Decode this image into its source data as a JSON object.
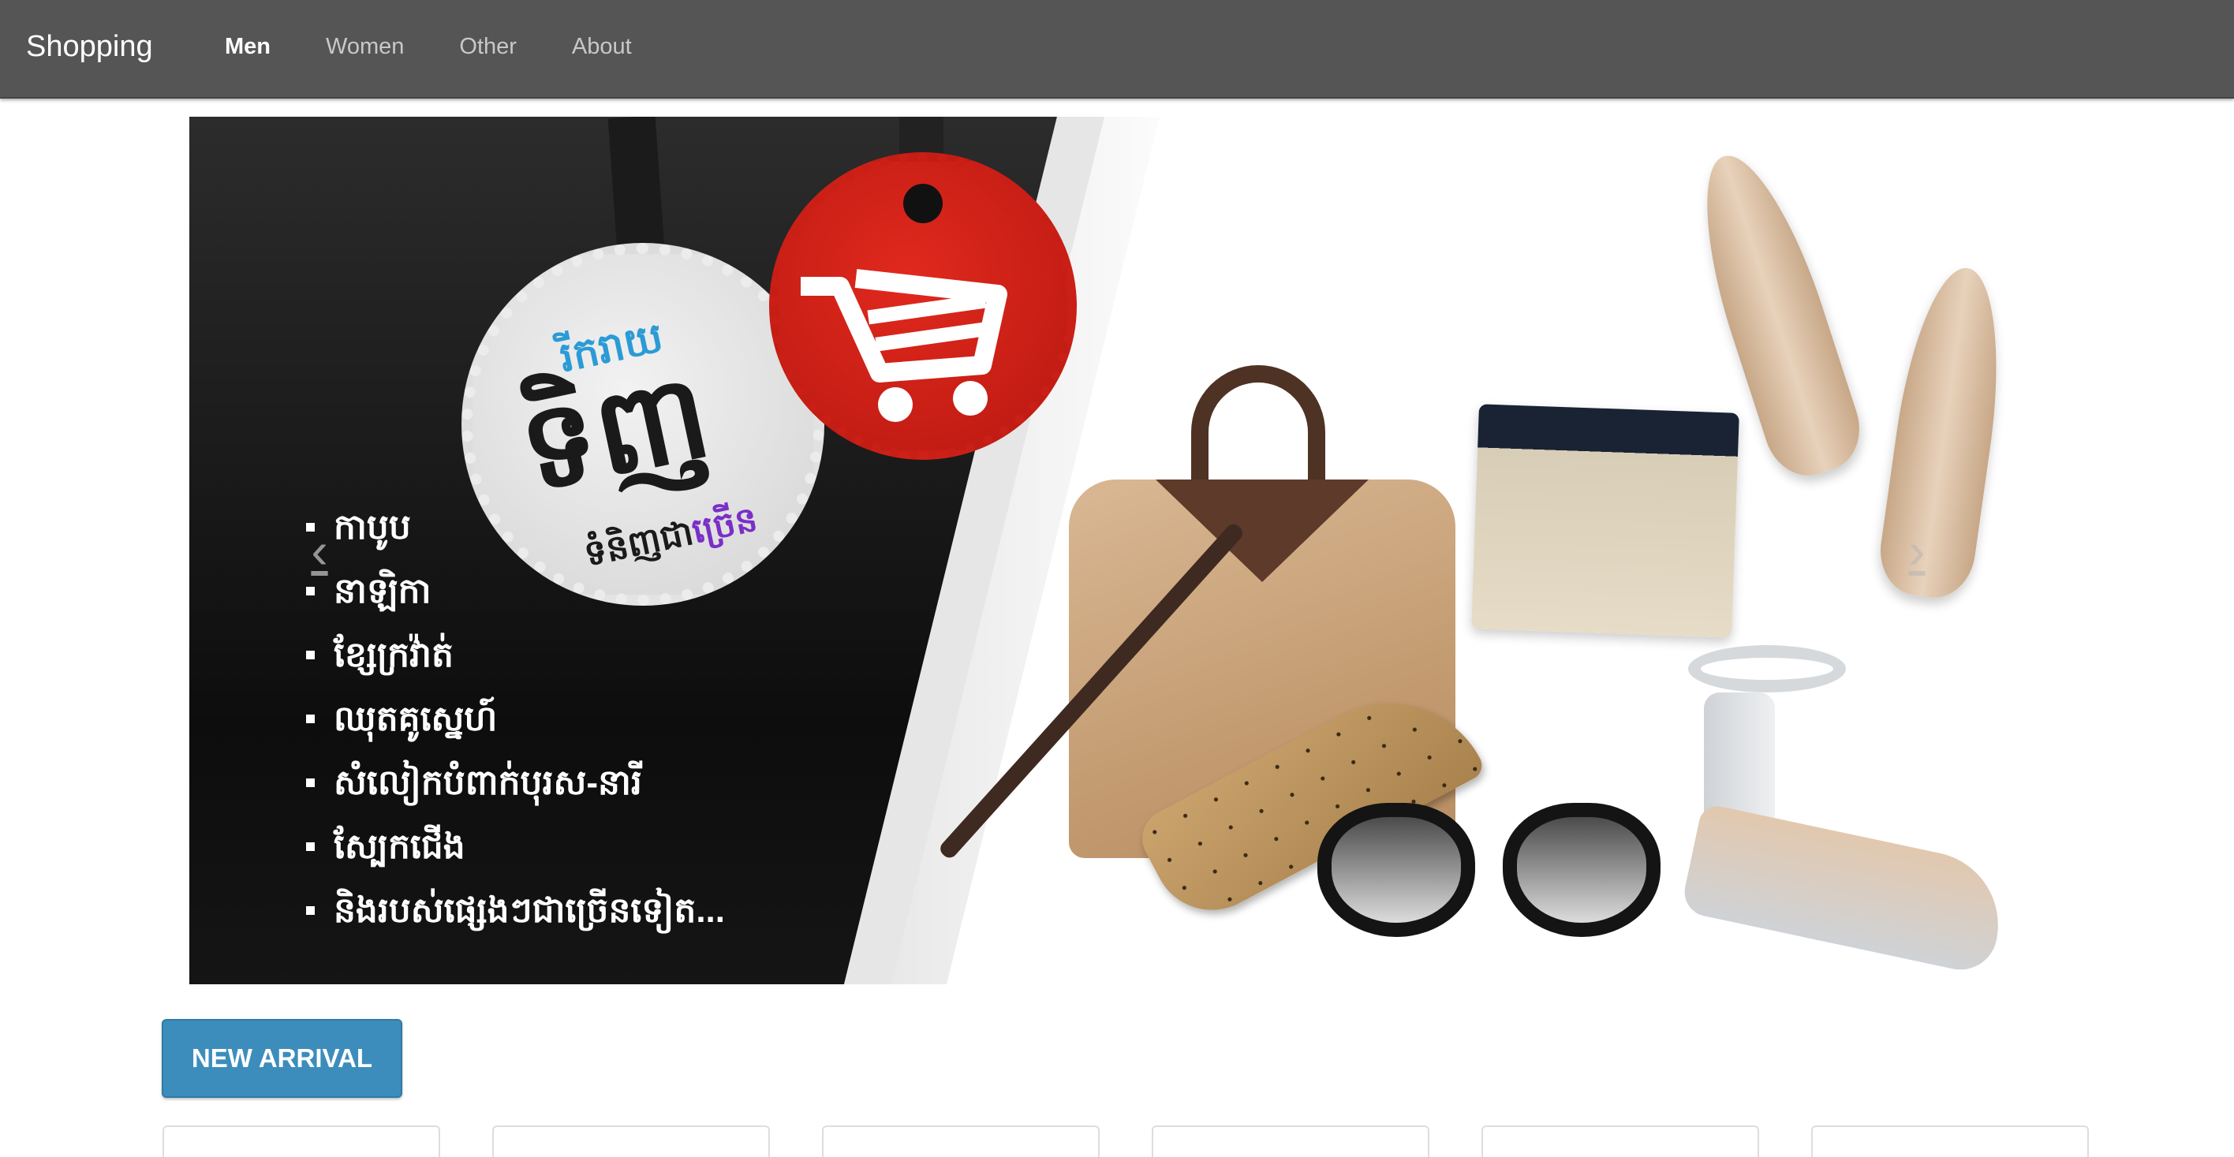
{
  "navbar": {
    "brand": "Shopping",
    "items": [
      {
        "label": "Men",
        "active": true
      },
      {
        "label": "Women",
        "active": false
      },
      {
        "label": "Other",
        "active": false
      },
      {
        "label": "About",
        "active": false
      }
    ]
  },
  "carousel": {
    "prev_icon": "chevron-left-icon",
    "next_icon": "chevron-right-icon",
    "prev_glyph": "‹",
    "next_glyph": "›",
    "slide": {
      "tag_text_top": "រីករាយ",
      "tag_text_big": "ទិញ",
      "tag_text_bottom_prefix": "ទំនិញជា",
      "tag_text_bottom_accent": "ច្រើន",
      "list_items": [
        "កាបូប",
        "នាឡិកា",
        "ខ្សែក្រវ៉ាត់",
        "ឈុតគូស្នេហ៍",
        "សំលៀកបំពាក់បុរស-នារី",
        "ស្បែកជើង",
        "និងរបស់ផ្សេងៗជាច្រើនទៀត..."
      ]
    }
  },
  "section": {
    "new_arrival_label": "NEW ARRIVAL"
  },
  "colors": {
    "navbar_bg": "#555555",
    "button_bg": "#3c8dbc",
    "tag_red": "#d42219",
    "accent_blue": "#2b9bd6",
    "accent_purple": "#7a2fc7"
  }
}
